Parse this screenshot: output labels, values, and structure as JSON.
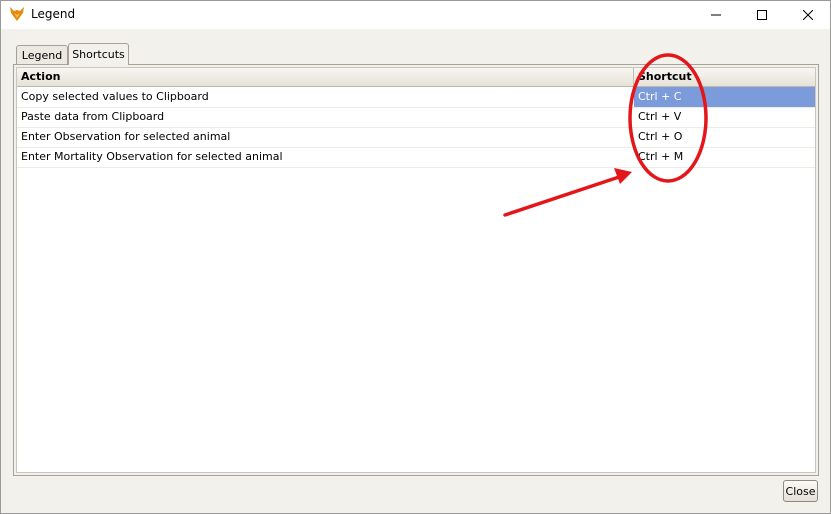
{
  "window": {
    "title": "Legend",
    "app_icon": "fox-icon",
    "controls": [
      "minimize-icon",
      "maximize-icon",
      "close-icon"
    ]
  },
  "tabs": [
    {
      "label": "Legend",
      "active": false
    },
    {
      "label": "Shortcuts",
      "active": true
    }
  ],
  "table": {
    "columns": [
      "Action",
      "Shortcut"
    ],
    "rows": [
      {
        "action": "Copy selected values to Clipboard",
        "shortcut": "Ctrl + C",
        "selected": true
      },
      {
        "action": "Paste data from Clipboard",
        "shortcut": "Ctrl + V",
        "selected": false
      },
      {
        "action": "Enter Observation for selected animal",
        "shortcut": "Ctrl + O",
        "selected": false
      },
      {
        "action": "Enter Mortality Observation for selected animal",
        "shortcut": "Ctrl + M",
        "selected": false
      }
    ]
  },
  "footer": {
    "close_label": "Close"
  },
  "colors": {
    "selection": "#7b9bdb",
    "annotation": "#e3171b"
  }
}
